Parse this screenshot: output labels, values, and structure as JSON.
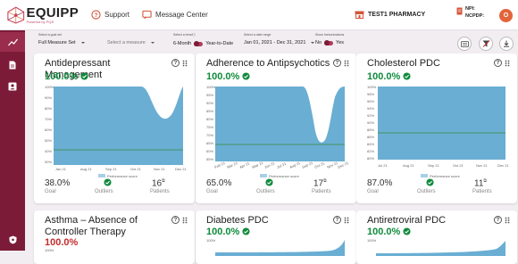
{
  "brand": {
    "name": "EQUIPP",
    "tagline": "Powered by PQS"
  },
  "nav": {
    "support": "Support",
    "message_center": "Message Center"
  },
  "account": {
    "pharmacy": "TEST1 PHARMACY",
    "npi_label": "NPI:",
    "ncpdp_label": "NCPDP:",
    "avatar_initial": "O"
  },
  "filters": {
    "goal_set": {
      "label": "Select a goal set",
      "value": "Full Measure Set"
    },
    "measure": {
      "placeholder": "Select a measure"
    },
    "trend": {
      "label": "Select a trendⓘ",
      "left": "6-Month",
      "right": "Year-to-Date"
    },
    "date_range": {
      "label": "Select a date range",
      "value": "Jan 01, 2021 - Dec 31, 2021"
    },
    "immunizations": {
      "label": "Show Immunizations",
      "left": "No",
      "right": "Yes"
    }
  },
  "labels": {
    "goal": "Goal",
    "outliers": "Outliers",
    "patients": "Patients",
    "legend": "Performance score"
  },
  "colors": {
    "brand": "#7c1b38",
    "area": "#5fa4cb",
    "goal_line": "#3b8a3b",
    "good": "#0f8a3c",
    "bad": "#c22c2c"
  },
  "cards": [
    {
      "title": "Antidepressant Management",
      "score": "100.0%",
      "status": "good",
      "goal": "38.0%",
      "patients": "16",
      "y_ticks": [
        "100%",
        "90%",
        "80%",
        "70%",
        "60%",
        "50%",
        "40%",
        "30%"
      ],
      "x_ticks": [
        "Jan 21",
        "Aug 21",
        "Sep 21",
        "Oct 21",
        "Nov 21",
        "Dec 21"
      ]
    },
    {
      "title": "Adherence to Antipsychotics",
      "score": "100.0%",
      "status": "good",
      "goal": "65.0%",
      "patients": "17",
      "y_ticks": [
        "100%",
        "95%",
        "90%",
        "85%",
        "80%",
        "75%",
        "70%",
        "65%",
        "60%",
        "55%"
      ],
      "x_ticks": [
        "Feb 21",
        "Mar 21",
        "Apr 21",
        "May 21",
        "Jun 21",
        "Jul 21",
        "Aug 21",
        "Sep 21",
        "Oct 21",
        "Nov 21",
        "Dec 21"
      ]
    },
    {
      "title": "Cholesterol PDC",
      "score": "100.0%",
      "status": "good",
      "goal": "87.0%",
      "patients": "11",
      "y_ticks": [
        "100%",
        "98%",
        "96%",
        "94%",
        "92%",
        "90%",
        "88%",
        "86%",
        "84%",
        "82%",
        "80%"
      ],
      "x_ticks": [
        "Jul 21",
        "Aug 21",
        "Sep 21",
        "Oct 21",
        "Nov 21",
        "Dec 21"
      ]
    },
    {
      "title": "Asthma – Absence of Controller Therapy",
      "score": "100.0%",
      "status": "bad",
      "y_ticks": [
        "100%"
      ]
    },
    {
      "title": "Diabetes PDC",
      "score": "100.0%",
      "status": "good",
      "y_ticks": [
        "100%"
      ]
    },
    {
      "title": "Antiretroviral PDC",
      "score": "100.0%",
      "status": "good",
      "y_ticks": [
        "100%"
      ]
    }
  ]
}
